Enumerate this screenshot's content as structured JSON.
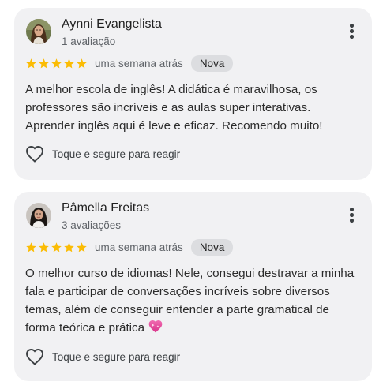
{
  "reviews": [
    {
      "author": "Aynni Evangelista",
      "review_count": "1 avaliação",
      "rating": 5,
      "time": "uma semana atrás",
      "badge": "Nova",
      "text": "A melhor escola de inglês! A didática é maravilhosa, os professores são incríveis e as aulas super interativas. Aprender inglês aqui é leve e eficaz. Recomendo muito!",
      "emoji": "",
      "react_label": "Toque e segure para reagir"
    },
    {
      "author": "Pâmella Freitas",
      "review_count": "3 avaliações",
      "rating": 5,
      "time": "uma semana atrás",
      "badge": "Nova",
      "text": "O melhor curso de idiomas! Nele, consegui destravar a minha fala e participar de conversações incríveis sobre diversos temas, além de conseguir entender a parte gramatical de forma teórica e prática",
      "emoji": "sparkling-heart",
      "react_label": "Toque e segure para reagir"
    }
  ],
  "colors": {
    "card_bg": "#f1f1f3",
    "star": "#fbbc04",
    "badge_bg": "#dcdde0",
    "secondary_text": "#5f6368"
  }
}
